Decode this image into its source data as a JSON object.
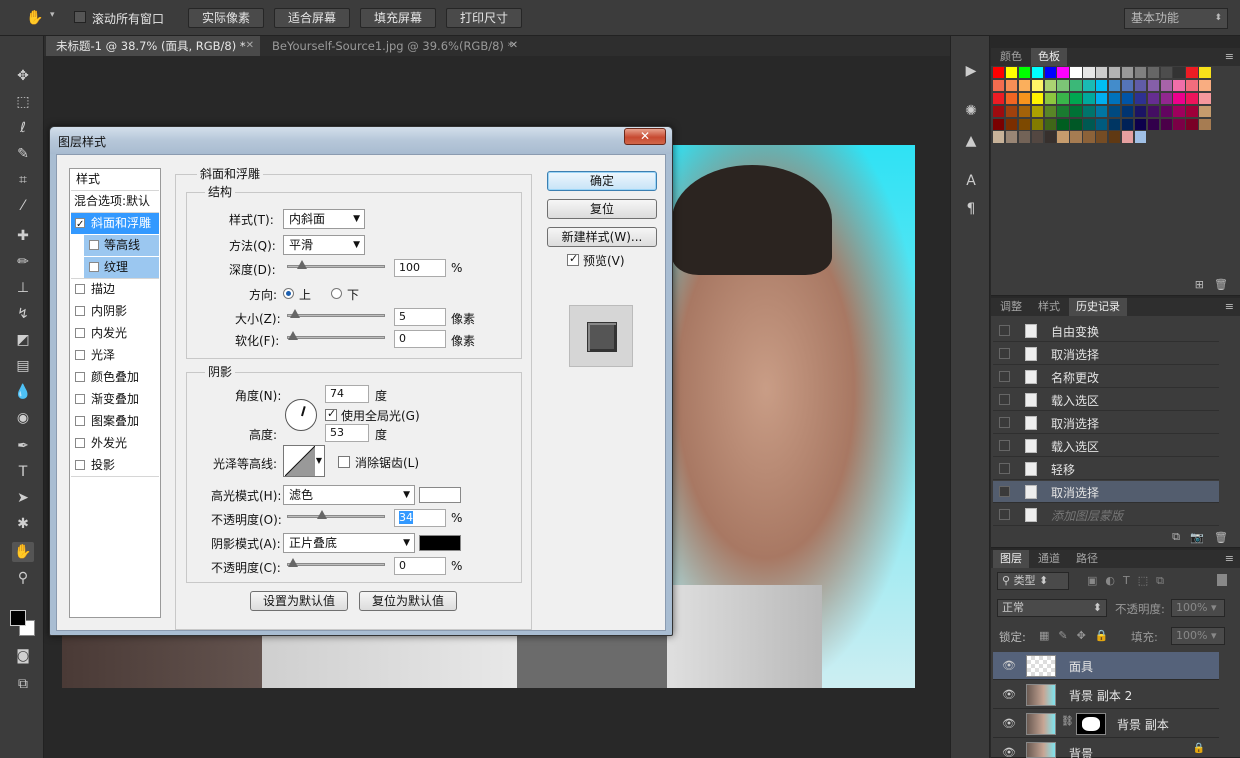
{
  "options_bar": {
    "scroll_all_label": "滚动所有窗口",
    "btn_actual": "实际像素",
    "btn_fit": "适合屏幕",
    "btn_fill": "填充屏幕",
    "btn_print": "打印尺寸",
    "workspace": "基本功能"
  },
  "tabs": [
    {
      "label": "未标题-1 @ 38.7% (面具, RGB/8) *"
    },
    {
      "label": "BeYourself-Source1.jpg @ 39.6%(RGB/8) *"
    }
  ],
  "color_panel": {
    "tab1": "颜色",
    "tab2": "色板",
    "swatches": [
      "#ff0000",
      "#ffff00",
      "#00ff00",
      "#00ffff",
      "#0000ff",
      "#ff00ff",
      "#ffffff",
      "#e6e6e6",
      "#cccccc",
      "#b3b3b3",
      "#999999",
      "#808080",
      "#666666",
      "#4d4d4d",
      "#333333",
      "#ed1c24",
      "#f7e11a",
      "#f26c4f",
      "#f68e56",
      "#fbaf5c",
      "#fff467",
      "#acd372",
      "#7cc576",
      "#3bb878",
      "#1abbb4",
      "#00bff3",
      "#438ccb",
      "#5574b9",
      "#605ca8",
      "#855fa8",
      "#a763a9",
      "#f06ea9",
      "#f26d7d",
      "#f9ad81",
      "#ed1c24",
      "#f26522",
      "#f7941d",
      "#fff200",
      "#8dc63f",
      "#39b54a",
      "#00a651",
      "#00a99d",
      "#00aeef",
      "#0072bc",
      "#0054a6",
      "#2e3192",
      "#662d91",
      "#92278f",
      "#ec008c",
      "#ed145b",
      "#f5989d",
      "#9e0b0f",
      "#a0410d",
      "#a36209",
      "#aba000",
      "#598527",
      "#1a7b30",
      "#007236",
      "#00746b",
      "#0076a3",
      "#004a80",
      "#003471",
      "#1b1464",
      "#440e62",
      "#630460",
      "#9e005d",
      "#9e0039",
      "#c69c6d",
      "#790000",
      "#7b2e00",
      "#7d4900",
      "#827b00",
      "#406618",
      "#005e20",
      "#005826",
      "#005952",
      "#005b7f",
      "#003663",
      "#002157",
      "#0d004c",
      "#32004b",
      "#4b0049",
      "#7b0046",
      "#7a0026",
      "#a67c52",
      "#c7b299",
      "#998675",
      "#736357",
      "#534741",
      "#37302d",
      "#c69c6d",
      "#a67c52",
      "#8c6239",
      "#754c24",
      "#603913",
      "#e6a0a0",
      "#a0c0e6",
      "#3c3c3c",
      "#3c3c3c",
      "#3c3c3c",
      "#3c3c3c",
      "#3c3c3c"
    ]
  },
  "history_panel": {
    "tab1": "调整",
    "tab2": "样式",
    "tab3": "历史记录",
    "items": [
      "自由变换",
      "取消选择",
      "名称更改",
      "载入选区",
      "取消选择",
      "载入选区",
      "轻移",
      "取消选择",
      "添加图层蒙版"
    ]
  },
  "layers_panel": {
    "tab1": "图层",
    "tab2": "通道",
    "tab3": "路径",
    "kind_filter": "类型",
    "blend_mode": "正常",
    "opacity_label": "不透明度:",
    "opacity_value": "100%",
    "lock_label": "锁定:",
    "fill_label": "填充:",
    "fill_value": "100%",
    "layers": [
      "面具",
      "背景 副本 2",
      "背景 副本",
      "背景"
    ]
  },
  "dialog": {
    "title": "图层样式",
    "close": "✕",
    "style_list": {
      "header": "样式",
      "blend": "混合选项:默认",
      "items": [
        {
          "label": "斜面和浮雕",
          "checked": true
        },
        {
          "label": "等高线",
          "checked": false
        },
        {
          "label": "纹理",
          "checked": false
        },
        {
          "label": "描边",
          "checked": false
        },
        {
          "label": "内阴影",
          "checked": false
        },
        {
          "label": "内发光",
          "checked": false
        },
        {
          "label": "光泽",
          "checked": false
        },
        {
          "label": "颜色叠加",
          "checked": false
        },
        {
          "label": "渐变叠加",
          "checked": false
        },
        {
          "label": "图案叠加",
          "checked": false
        },
        {
          "label": "外发光",
          "checked": false
        },
        {
          "label": "投影",
          "checked": false
        }
      ]
    },
    "section_title": "斜面和浮雕",
    "structure": {
      "title": "结构",
      "style_label": "样式(T):",
      "style_value": "内斜面",
      "technique_label": "方法(Q):",
      "technique_value": "平滑",
      "depth_label": "深度(D):",
      "depth_value": "100",
      "depth_unit": "%",
      "direction_label": "方向:",
      "dir_up": "上",
      "dir_down": "下",
      "size_label": "大小(Z):",
      "size_value": "5",
      "size_unit": "像素",
      "soften_label": "软化(F):",
      "soften_value": "0",
      "soften_unit": "像素",
      "depth_slider": 0.1,
      "size_slider": 0.02,
      "soften_slider": 0.0
    },
    "shading": {
      "title": "阴影",
      "angle_label": "角度(N):",
      "angle_value": "74",
      "angle_unit": "度",
      "global_light": "使用全局光(G)",
      "altitude_label": "高度:",
      "altitude_value": "53",
      "altitude_unit": "度",
      "gloss_label": "光泽等高线:",
      "anti_alias": "消除锯齿(L)",
      "highlight_label": "高光模式(H):",
      "highlight_value": "滤色",
      "highlight_color": "#ffffff",
      "hl_opacity_label": "不透明度(O):",
      "hl_opacity_value": "34",
      "hl_opacity_unit": "%",
      "shadow_label": "阴影模式(A):",
      "shadow_value": "正片叠底",
      "shadow_color": "#000000",
      "sh_opacity_label": "不透明度(C):",
      "sh_opacity_value": "0",
      "sh_opacity_unit": "%",
      "hl_opacity_slider": 0.34,
      "sh_opacity_slider": 0.0
    },
    "btn_make_default": "设置为默认值",
    "btn_reset_default": "复位为默认值",
    "btn_ok": "确定",
    "btn_reset": "复位",
    "btn_new_style": "新建样式(W)...",
    "preview_label": "预览(V)"
  }
}
